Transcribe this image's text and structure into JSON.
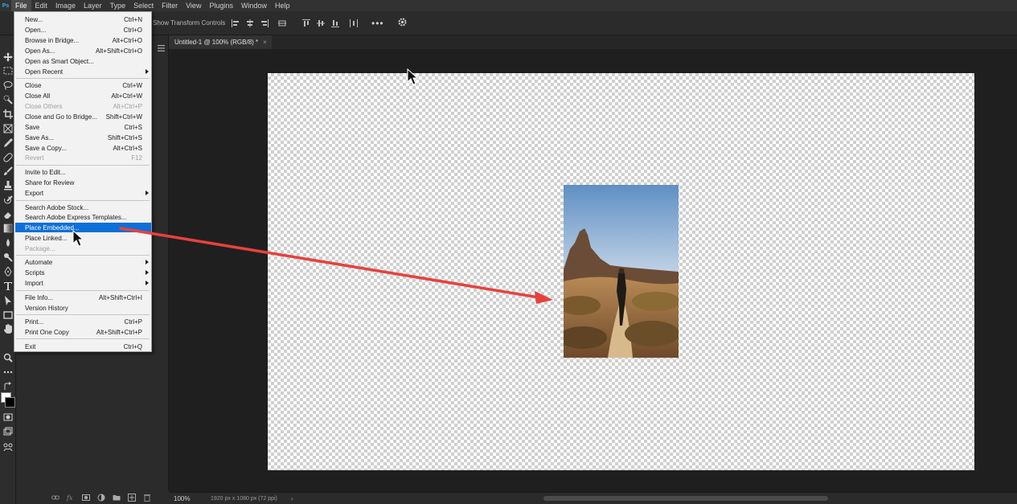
{
  "menubar": {
    "logo": "Ps",
    "items": [
      "File",
      "Edit",
      "Image",
      "Layer",
      "Type",
      "Select",
      "Filter",
      "View",
      "Plugins",
      "Window",
      "Help"
    ]
  },
  "optionsbar": {
    "show_transform_controls": "Show Transform Controls",
    "more": "•••"
  },
  "document": {
    "tab_title": "Untitled-1 @ 100% (RGB/8) *",
    "close": "×"
  },
  "statusbar": {
    "zoom": "100%",
    "doc_size": "1920 px x 1080 px (72 ppi)",
    "arrow": "›"
  },
  "file_menu": {
    "items": [
      {
        "label": "New...",
        "shortcut": "Ctrl+N"
      },
      {
        "label": "Open...",
        "shortcut": "Ctrl+O"
      },
      {
        "label": "Browse in Bridge...",
        "shortcut": "Alt+Ctrl+O"
      },
      {
        "label": "Open As...",
        "shortcut": "Alt+Shift+Ctrl+O"
      },
      {
        "label": "Open as Smart Object...",
        "shortcut": ""
      },
      {
        "label": "Open Recent",
        "shortcut": ""
      },
      {
        "label": "Close",
        "shortcut": "Ctrl+W"
      },
      {
        "label": "Close All",
        "shortcut": "Alt+Ctrl+W"
      },
      {
        "label": "Close Others",
        "shortcut": "Alt+Ctrl+P"
      },
      {
        "label": "Close and Go to Bridge...",
        "shortcut": "Shift+Ctrl+W"
      },
      {
        "label": "Save",
        "shortcut": "Ctrl+S"
      },
      {
        "label": "Save As...",
        "shortcut": "Shift+Ctrl+S"
      },
      {
        "label": "Save a Copy...",
        "shortcut": "Alt+Ctrl+S"
      },
      {
        "label": "Revert",
        "shortcut": "F12"
      },
      {
        "label": "Invite to Edit...",
        "shortcut": ""
      },
      {
        "label": "Share for Review",
        "shortcut": ""
      },
      {
        "label": "Export",
        "shortcut": ""
      },
      {
        "label": "Search Adobe Stock...",
        "shortcut": ""
      },
      {
        "label": "Search Adobe Express Templates...",
        "shortcut": ""
      },
      {
        "label": "Place Embedded...",
        "shortcut": ""
      },
      {
        "label": "Place Linked...",
        "shortcut": ""
      },
      {
        "label": "Package...",
        "shortcut": ""
      },
      {
        "label": "Automate",
        "shortcut": ""
      },
      {
        "label": "Scripts",
        "shortcut": ""
      },
      {
        "label": "Import",
        "shortcut": ""
      },
      {
        "label": "File Info...",
        "shortcut": "Alt+Shift+Ctrl+I"
      },
      {
        "label": "Version History",
        "shortcut": ""
      },
      {
        "label": "Print...",
        "shortcut": "Ctrl+P"
      },
      {
        "label": "Print One Copy",
        "shortcut": "Alt+Shift+Ctrl+P"
      },
      {
        "label": "Exit",
        "shortcut": "Ctrl+Q"
      }
    ]
  },
  "colors": {
    "menu_highlight": "#0d6fd9",
    "annotation_arrow": "#e8413c",
    "ps_blue": "#31a8ff"
  }
}
